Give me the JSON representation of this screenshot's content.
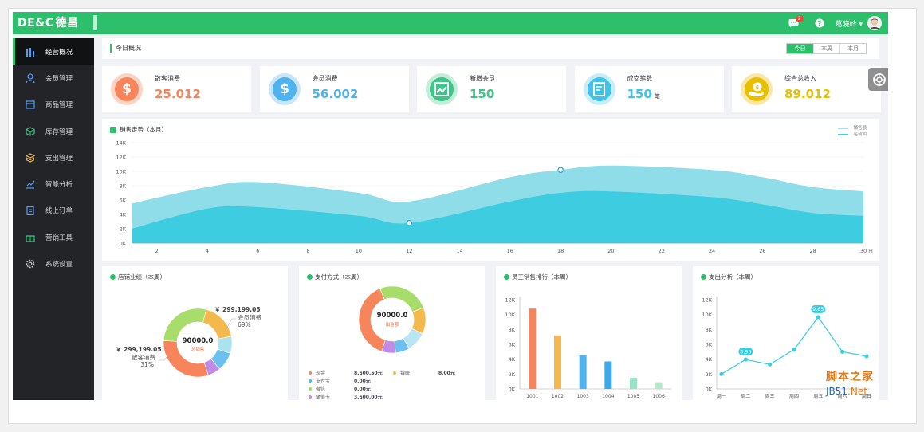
{
  "app": {
    "logo_text": "DE&C",
    "logo_cn": "德昌"
  },
  "topbar": {
    "message_badge": "2",
    "user_name": "葛晓岭 ▾"
  },
  "sidebar": {
    "items": [
      {
        "label": "经营概况",
        "icon": "bar-chart-icon",
        "active": true
      },
      {
        "label": "会员管理",
        "icon": "user-icon"
      },
      {
        "label": "商品管理",
        "icon": "box-icon"
      },
      {
        "label": "库存管理",
        "icon": "cube-icon"
      },
      {
        "label": "支出管理",
        "icon": "layers-icon"
      },
      {
        "label": "智能分析",
        "icon": "trend-chart-icon"
      },
      {
        "label": "线上订单",
        "icon": "clipboard-icon"
      },
      {
        "label": "营销工具",
        "icon": "gift-icon"
      },
      {
        "label": "系统设置",
        "icon": "gear-icon"
      }
    ]
  },
  "today": {
    "title": "今日概况",
    "tabs": [
      "今日",
      "本周",
      "本月"
    ],
    "active_tab": "今日"
  },
  "stats": [
    {
      "label": "散客消费",
      "value": "25.012",
      "unit": "",
      "color": "#f7855c",
      "bg": "#fbd4c3",
      "icon": "dollar-icon"
    },
    {
      "label": "会员消费",
      "value": "56.002",
      "unit": "",
      "color": "#4fb3ef",
      "bg": "#c8e6f8",
      "icon": "dollar-icon"
    },
    {
      "label": "新增会员",
      "value": "150",
      "unit": "",
      "color": "#3dc58a",
      "bg": "#c5eed9",
      "icon": "trend-up-icon"
    },
    {
      "label": "成交笔数",
      "value": "150",
      "unit": "笔",
      "color": "#3fc3ea",
      "bg": "#c9eef8",
      "icon": "edit-icon"
    },
    {
      "label": "综合总收入",
      "value": "89.012",
      "unit": "",
      "color": "#e8c000",
      "bg": "#fae7a5",
      "icon": "coin-hand-icon"
    }
  ],
  "sales": {
    "title": "销售走势（本月）",
    "legend": [
      "销售额",
      "毛利润"
    ]
  },
  "store": {
    "title": "店铺业绩（本周）",
    "center_value": "90000.0",
    "center_label": "总销售",
    "right_amount": "￥ 299,199.05",
    "right_name": "会员消费",
    "right_pct": "69%",
    "left_amount": "￥ 299,199.05",
    "left_name": "散客消费",
    "left_pct": "31%"
  },
  "payment": {
    "title": "支付方式（本周）",
    "center_value": "90000.0",
    "center_label": "出金额",
    "rows": [
      {
        "name": "现金",
        "value": "8,600.50元",
        "color": "#f7855c"
      },
      {
        "name": "银联",
        "value": "8.00元",
        "color": "#f4b94d"
      },
      {
        "name": "支付宝",
        "value": "0.00元",
        "color": "#4fb3ef"
      },
      {
        "name": "微信",
        "value": "0.00元",
        "color": "#a3da6a"
      },
      {
        "name": "储值卡",
        "value": "3,600.00元",
        "color": "#c38be8"
      }
    ]
  },
  "staff": {
    "title": "员工销售排行（本周）",
    "icon": "user-icon"
  },
  "expense": {
    "title": "支出分析（本周）"
  },
  "watermark": {
    "line1": "脚本之家",
    "line2a": "JB51",
    "line2b": ".Net"
  },
  "chart_data": [
    {
      "type": "area",
      "title": "销售走势（本月）",
      "xlabel": "日",
      "x": [
        1,
        4,
        6,
        10,
        12,
        16,
        18,
        20,
        24,
        26,
        28,
        30
      ],
      "series": [
        {
          "name": "销售额",
          "values": [
            5500,
            7800,
            8500,
            7000,
            5800,
            9200,
            10200,
            10800,
            10200,
            9200,
            7800,
            7200
          ]
        },
        {
          "name": "毛利润",
          "values": [
            2000,
            4800,
            5000,
            3800,
            2800,
            5800,
            7000,
            7200,
            6400,
            5400,
            4200,
            3800
          ]
        }
      ],
      "ylim": [
        0,
        14000
      ],
      "yticks": [
        "0K",
        "2K",
        "4K",
        "6K",
        "8K",
        "10K",
        "12K",
        "14K"
      ],
      "xticks": [
        2,
        4,
        6,
        8,
        10,
        12,
        14,
        16,
        18,
        20,
        22,
        24,
        26,
        28,
        30
      ]
    },
    {
      "type": "pie",
      "title": "店铺业绩（本周）",
      "values": [
        69,
        31
      ],
      "categories": [
        "会员消费",
        "散客消费"
      ]
    },
    {
      "type": "pie",
      "title": "支付方式（本周）",
      "values": [
        8600.5,
        8.0,
        0.0,
        0.0,
        3600.0
      ],
      "categories": [
        "现金",
        "银联",
        "支付宝",
        "微信",
        "储值卡"
      ]
    },
    {
      "type": "bar",
      "title": "员工销售排行（本周）",
      "categories": [
        "1001",
        "1002",
        "1003",
        "1004",
        "1005",
        "1006"
      ],
      "values": [
        10800,
        7200,
        4500,
        3700,
        1500,
        900
      ],
      "colors": [
        "#f7855c",
        "#f4b94d",
        "#4fb3ef",
        "#3fa9e8",
        "#9be3c3",
        "#b5e8c9"
      ],
      "ylim": [
        0,
        12000
      ],
      "yticks": [
        "0K",
        "2K",
        "4K",
        "6K",
        "8K",
        "10K",
        "12K"
      ]
    },
    {
      "type": "line",
      "title": "支出分析（本周）",
      "categories": [
        "周一",
        "周二",
        "周三",
        "周四",
        "周五",
        "周六",
        "周日"
      ],
      "values": [
        2000,
        3950,
        3300,
        5300,
        9650,
        5000,
        4400
      ],
      "ylim": [
        0,
        12000
      ],
      "yticks": [
        "0K",
        "2K",
        "4K",
        "6K",
        "8K",
        "10K",
        "12K"
      ],
      "labels": [
        {
          "value": "3.95"
        },
        {
          "value": "9.65"
        }
      ]
    }
  ]
}
